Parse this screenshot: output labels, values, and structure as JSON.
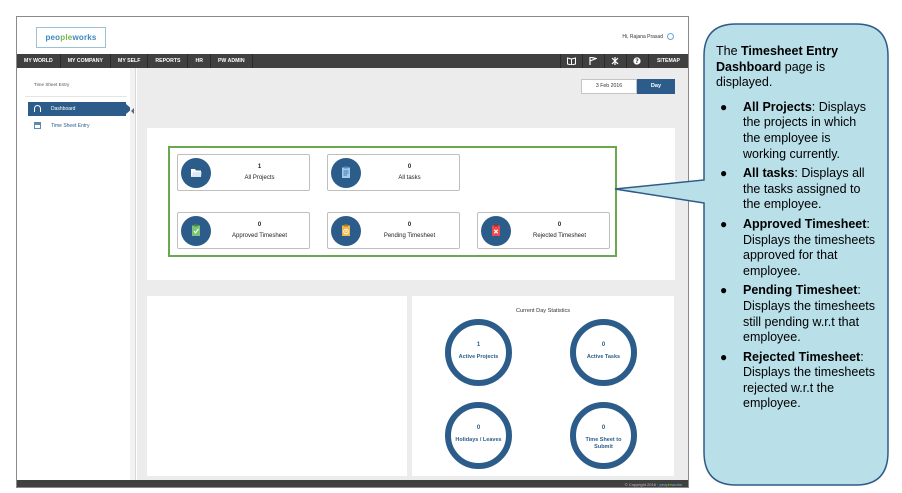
{
  "app": {
    "logo": {
      "prefix": "peo",
      "accent": "ple",
      "suffix": "works"
    },
    "greeting": "Hi, Rajana Prasad"
  },
  "nav": {
    "items": [
      "MY WORLD",
      "MY COMPANY",
      "MY SELF",
      "REPORTS",
      "HR",
      "PW ADMIN"
    ],
    "icons": [
      "book-icon",
      "flag-icon",
      "tools-icon",
      "help-icon"
    ],
    "sitemap": "SITEMAP"
  },
  "sidebar": {
    "title": "Time Sheet Entry",
    "items": [
      {
        "label": "Dashboard",
        "icon": "dashboard-icon",
        "active": true
      },
      {
        "label": "Time Sheet Entry",
        "icon": "calendar-icon",
        "active": false
      }
    ]
  },
  "datebar": {
    "date": "3 Feb 2016",
    "view_button": "Day"
  },
  "tiles": [
    {
      "count": "1",
      "label": "All Projects",
      "icon": "folder-icon",
      "color": "#ffffff"
    },
    {
      "count": "0",
      "label": "All tasks",
      "icon": "clipboard-icon",
      "color": "#9ecbf0"
    },
    {
      "count": "0",
      "label": "Approved Timesheet",
      "icon": "approved-clipboard-icon",
      "color": "#7cc576"
    },
    {
      "count": "0",
      "label": "Pending Timesheet",
      "icon": "pending-clipboard-icon",
      "color": "#f2b84b"
    },
    {
      "count": "0",
      "label": "Rejected Timesheet",
      "icon": "rejected-clipboard-icon",
      "color": "#e84c4c"
    }
  ],
  "statistics": {
    "title": "Current Day Statistics",
    "items": [
      {
        "value": "1",
        "label": "Active Projects"
      },
      {
        "value": "0",
        "label": "Active Tasks"
      },
      {
        "value": "0",
        "label": "Holidays / Leaves"
      },
      {
        "value": "0",
        "label": "Time Sheet to Submit"
      }
    ]
  },
  "footer": {
    "copyright": "© Copyright 2016 ·",
    "brand": "peo",
    "brand_accent": "ple",
    "brand_suffix": "works"
  },
  "callout": {
    "intro_prefix": "The ",
    "intro_bold": "Timesheet Entry Dashboard",
    "intro_suffix": " page is displayed.",
    "items": [
      {
        "term": "All Projects",
        "text": ": Displays the projects in which the employee is working currently."
      },
      {
        "term": "All tasks",
        "text": ": Displays all the tasks assigned to the employee."
      },
      {
        "term": "Approved Timesheet",
        "text": ": Displays the timesheets approved for that employee."
      },
      {
        "term": "Pending Timesheet",
        "text": ": Displays the timesheets still pending w.r.t that employee."
      },
      {
        "term": "Rejected Timesheet",
        "text": ": Displays the timesheets rejected w.r.t the employee."
      }
    ],
    "fill_color": "#b9dfe9",
    "border_color": "#2f5b87"
  },
  "colors": {
    "primary": "#2c5d8a",
    "nav_bg": "#404040",
    "highlight_border": "#6aa84f"
  }
}
